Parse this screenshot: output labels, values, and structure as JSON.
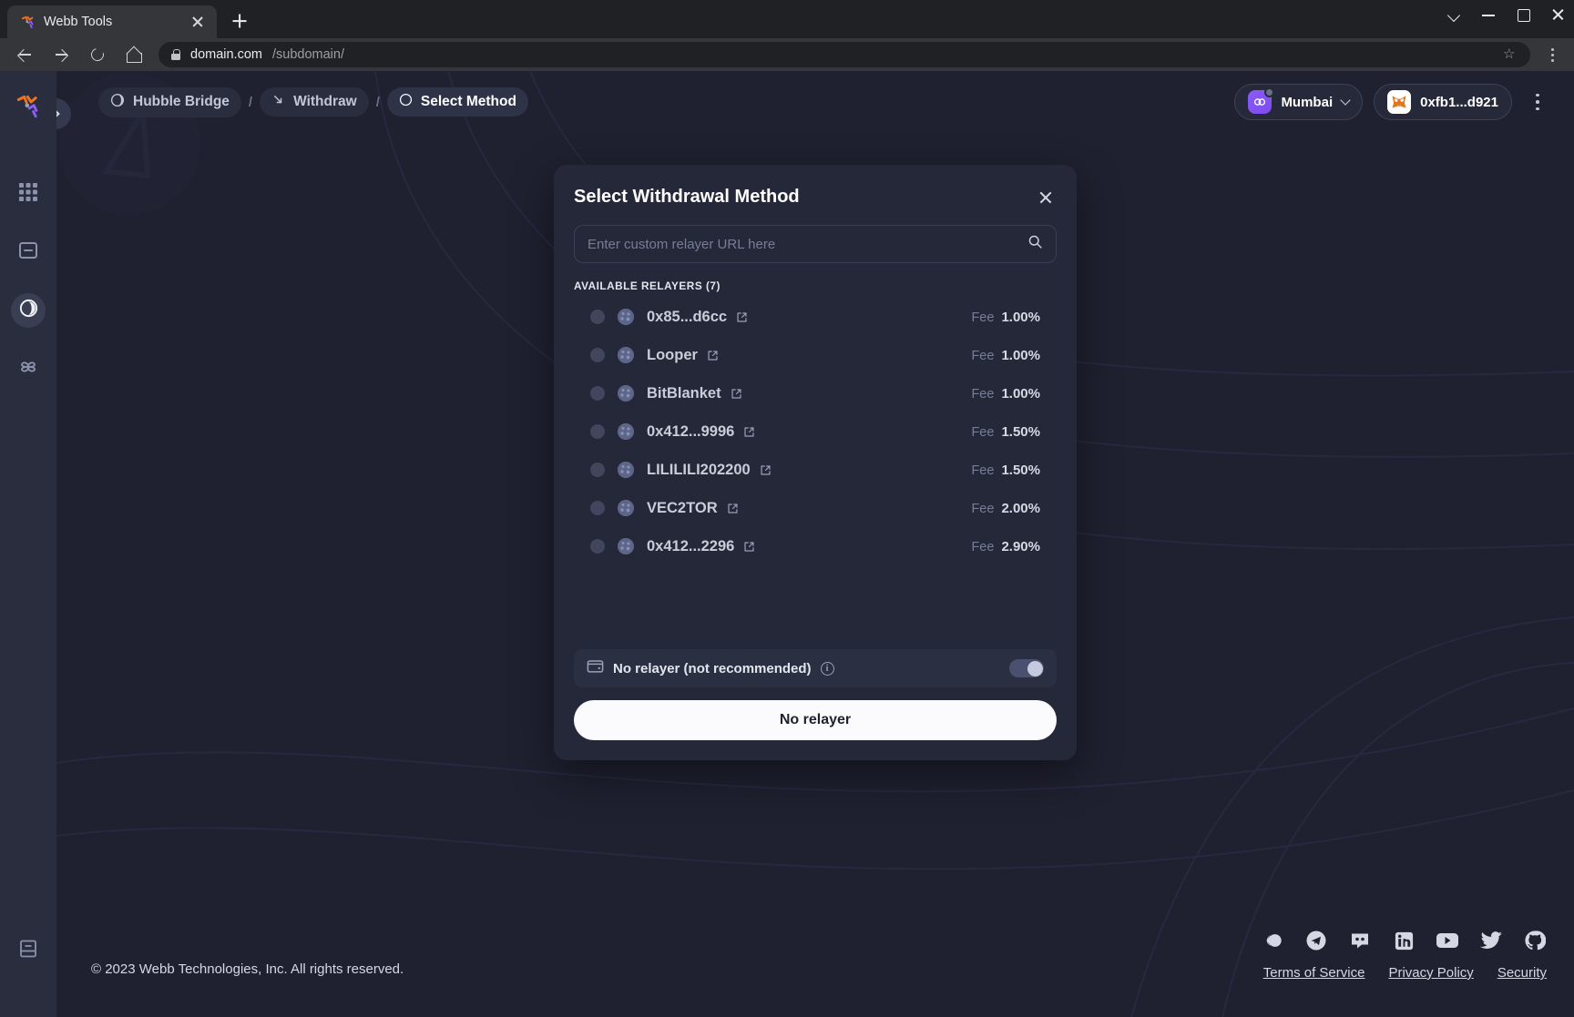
{
  "browser": {
    "tab": {
      "title": "Webb Tools",
      "favicon_icon": "webb-logo-icon",
      "close_icon": "close-icon"
    },
    "new_tab_icon": "plus-icon",
    "window_controls": [
      "chevron-down-icon",
      "minimize-icon",
      "maximize-icon",
      "close-icon"
    ],
    "nav": {
      "back_icon": "arrow-left-icon",
      "forward_icon": "arrow-right-icon",
      "reload_icon": "reload-icon",
      "home_icon": "home-icon"
    },
    "address": {
      "lock_icon": "lock-icon",
      "domain": "domain.com",
      "path": "/subdomain/",
      "bookmark_icon": "star-icon",
      "menu_icon": "kebab-menu-icon"
    }
  },
  "sidebar": {
    "logo_icon": "webb-logo-icon",
    "items": [
      {
        "name": "apps",
        "icon": "grid-apps-icon",
        "active": false
      },
      {
        "name": "statistics",
        "icon": "card-document-icon",
        "active": false
      },
      {
        "name": "bridge",
        "icon": "bridge-circle-icon",
        "active": true
      },
      {
        "name": "hubble",
        "icon": "hubble-flower-icon",
        "active": false
      }
    ],
    "bottom_item": {
      "name": "docs",
      "icon": "book-icon"
    },
    "expander_icon": "chevron-right-icon"
  },
  "topbar": {
    "breadcrumb": [
      {
        "label": "Hubble Bridge",
        "icon": "half-circle-icon",
        "active": false
      },
      {
        "label": "Withdraw",
        "icon": "arrow-down-right-icon",
        "active": false
      },
      {
        "label": "Select Method",
        "icon": "empty-circle-icon",
        "active": true
      }
    ],
    "separator": "/",
    "chain": {
      "label": "Mumbai",
      "icon": "polygon-chain-icon",
      "chevron_icon": "chevron-down-icon"
    },
    "wallet": {
      "address": "0xfb1...d921",
      "icon": "metamask-fox-icon"
    },
    "menu_icon": "kebab-menu-icon"
  },
  "modal": {
    "title": "Select Withdrawal Method",
    "close_icon": "close-icon",
    "search": {
      "placeholder": "Enter custom relayer URL here",
      "value": "",
      "icon": "search-icon"
    },
    "section_label": "AVAILABLE RELAYERS (7)",
    "fee_label": "Fee",
    "relayers": [
      {
        "name": "0x85...d6cc",
        "fee": "1.00%",
        "selected": false,
        "link_icon": "external-link-icon"
      },
      {
        "name": "Looper",
        "fee": "1.00%",
        "selected": false,
        "link_icon": "external-link-icon"
      },
      {
        "name": "BitBlanket",
        "fee": "1.00%",
        "selected": false,
        "link_icon": "external-link-icon"
      },
      {
        "name": "0x412...9996",
        "fee": "1.50%",
        "selected": false,
        "link_icon": "external-link-icon"
      },
      {
        "name": "LILILILI202200",
        "fee": "1.50%",
        "selected": false,
        "link_icon": "external-link-icon"
      },
      {
        "name": "VEC2TOR",
        "fee": "2.00%",
        "selected": false,
        "link_icon": "external-link-icon"
      },
      {
        "name": "0x412...2296",
        "fee": "2.90%",
        "selected": false,
        "link_icon": "external-link-icon"
      }
    ],
    "no_relayer": {
      "label": "No relayer (not recommended)",
      "icon": "wallet-card-icon",
      "info_icon": "info-icon",
      "toggle_on": true
    },
    "submit_label": "No relayer"
  },
  "footer": {
    "copyright": "© 2023 Webb Technologies, Inc. All rights reserved.",
    "socials": [
      "commons-icon",
      "telegram-icon",
      "discord-icon",
      "linkedin-icon",
      "youtube-icon",
      "twitter-icon",
      "github-icon"
    ],
    "links": [
      {
        "label": "Terms of Service"
      },
      {
        "label": "Privacy Policy"
      },
      {
        "label": "Security"
      }
    ]
  },
  "colors": {
    "page_bg": "#1f2130",
    "sidebar_bg": "#2a2d3e",
    "modal_bg": "#252839",
    "accent_purple": "#8b5cf6",
    "accent_orange": "#ee7422",
    "primary_btn_bg": "#fbfbfd"
  }
}
